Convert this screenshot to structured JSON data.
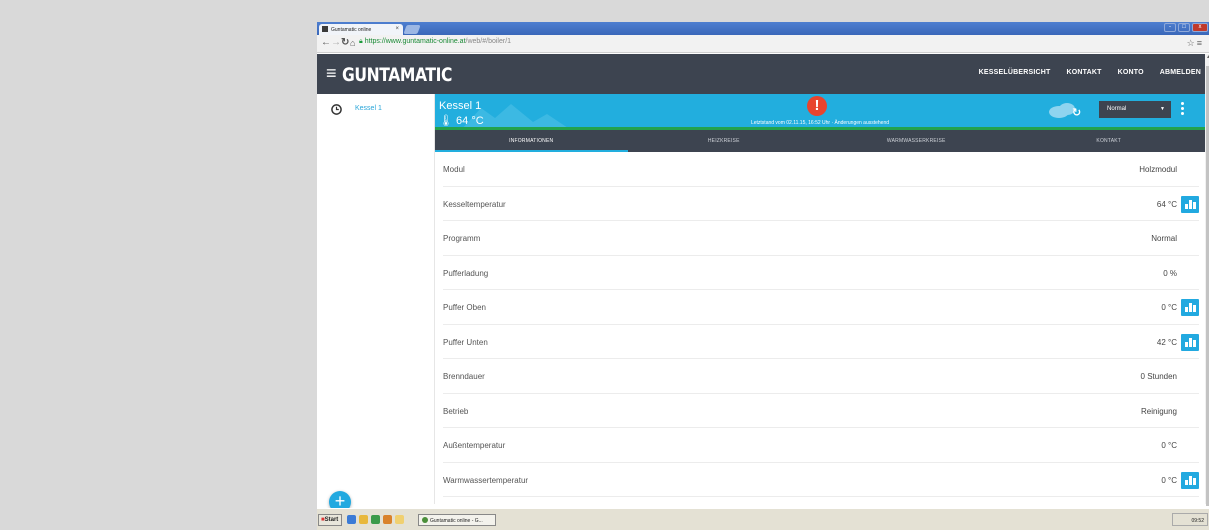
{
  "browser": {
    "tab_title": "Guntamatic online",
    "tab_close": "×",
    "url_scheme": "https://",
    "url_host": "www.guntamatic-online.at",
    "url_path": "/web/#/boiler/1",
    "window_buttons": [
      "-",
      "□",
      "x"
    ]
  },
  "app": {
    "logo": "GUNTAMATIC",
    "menu_icon": "hamburger-icon",
    "nav": [
      "KESSELÜBERSICHT",
      "KONTAKT",
      "KONTO",
      "ABMELDEN"
    ]
  },
  "sidebar": {
    "items": [
      {
        "label": "Kessel 1",
        "icon": "clock-icon"
      }
    ],
    "add_button": "+"
  },
  "boiler": {
    "title": "Kessel 1",
    "temperature": "64 °C",
    "alert_symbol": "!",
    "status": "Letztstand vom 02.11.15, 16:52 Uhr · Änderungen ausstehend",
    "mode_selected": "Normal",
    "colors": {
      "header": "#22aede",
      "alert": "#e8442d",
      "status_bar": "#23a24d"
    }
  },
  "tabs": [
    {
      "label": "INFORMATIONEN",
      "active": true
    },
    {
      "label": "HEIZKREISE",
      "active": false
    },
    {
      "label": "WARMWASSERKREISE",
      "active": false
    },
    {
      "label": "KONTAKT",
      "active": false
    }
  ],
  "info_rows": [
    {
      "label": "Modul",
      "value": "Holzmodul",
      "chart": false
    },
    {
      "label": "Kesseltemperatur",
      "value": "64 °C",
      "chart": true
    },
    {
      "label": "Programm",
      "value": "Normal",
      "chart": false
    },
    {
      "label": "Pufferladung",
      "value": "0 %",
      "chart": false
    },
    {
      "label": "Puffer Oben",
      "value": "0 °C",
      "chart": true
    },
    {
      "label": "Puffer Unten",
      "value": "42 °C",
      "chart": true
    },
    {
      "label": "Brenndauer",
      "value": "0 Stunden",
      "chart": false
    },
    {
      "label": "Betrieb",
      "value": "Reinigung",
      "chart": false
    },
    {
      "label": "Außentemperatur",
      "value": "0 °C",
      "chart": false
    },
    {
      "label": "Warmwassertemperatur",
      "value": "0 °C",
      "chart": true
    }
  ],
  "taskbar": {
    "start_label": "Start",
    "task_item": "Guntamatic online - G...",
    "clock": "09:52"
  }
}
